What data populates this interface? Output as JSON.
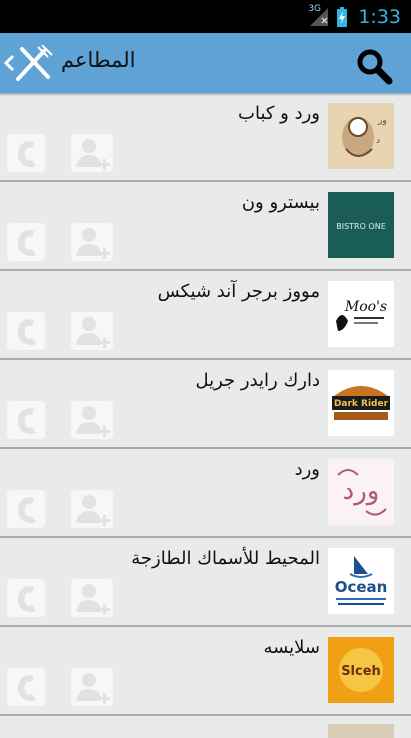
{
  "status_bar": {
    "network": "3G",
    "time": "1:33"
  },
  "action_bar": {
    "title": "المطاعم",
    "icon": "fork-knife-icon",
    "action_icon": "search-icon"
  },
  "restaurants": [
    {
      "name": "ورد و كباب",
      "logo_text": ""
    },
    {
      "name": "بيسترو ون",
      "logo_text": "BISTRO ONE"
    },
    {
      "name": "مووز برجر آند شيكس",
      "logo_text": "Moo's"
    },
    {
      "name": "دارك رايدر جريل",
      "logo_text": "Dark Rider"
    },
    {
      "name": "ورد",
      "logo_text": "ورد"
    },
    {
      "name": "المحيط للأسماك الطازجة",
      "logo_text": "Ocean"
    },
    {
      "name": "سلايسه",
      "logo_text": "Slceh"
    }
  ],
  "colors": {
    "action_bar": "#5fa2d6",
    "list_bg": "#e9eaea",
    "divider": "#a9abad",
    "clock": "#33b5e5"
  }
}
